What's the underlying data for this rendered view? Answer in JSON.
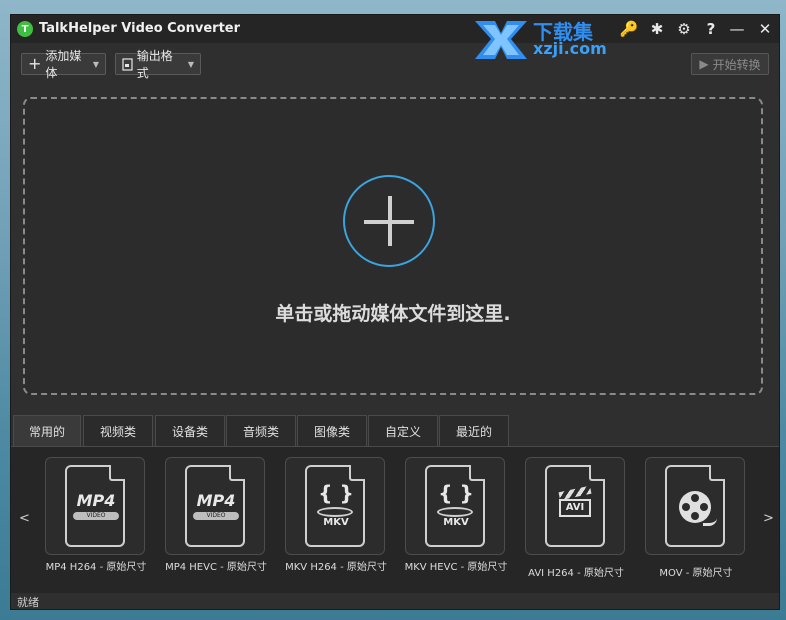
{
  "window": {
    "title": "TalkHelper Video Converter",
    "logo_letter": "T"
  },
  "watermark": {
    "line1": "下载集",
    "line2": "xzji.com"
  },
  "titlebar_icons": {
    "key": "🔑",
    "bug": "✱",
    "settings": "⚙",
    "help": "?",
    "minimize": "—",
    "close": "✕"
  },
  "toolbar": {
    "add_media_label": "添加媒体",
    "output_format_label": "输出格式",
    "start_convert_label": "开始转换"
  },
  "dropzone": {
    "hint": "单击或拖动媒体文件到这里."
  },
  "tabs": [
    {
      "label": "常用的",
      "active": true
    },
    {
      "label": "视频类",
      "active": false
    },
    {
      "label": "设备类",
      "active": false
    },
    {
      "label": "音频类",
      "active": false
    },
    {
      "label": "图像类",
      "active": false
    },
    {
      "label": "自定义",
      "active": false
    },
    {
      "label": "最近的",
      "active": false
    }
  ],
  "presets": [
    {
      "label": "MP4 H264 - 原始尺寸",
      "icon": "mp4-icon",
      "mark": "MP4",
      "sub": "VIDEO"
    },
    {
      "label": "MP4 HEVC - 原始尺寸",
      "icon": "mp4-icon",
      "mark": "MP4",
      "sub": "VIDEO"
    },
    {
      "label": "MKV H264 - 原始尺寸",
      "icon": "mkv-icon",
      "mark": "MKV"
    },
    {
      "label": "MKV HEVC - 原始尺寸",
      "icon": "mkv-icon",
      "mark": "MKV"
    },
    {
      "label": "AVI H264 - 原始尺寸",
      "icon": "avi-icon",
      "mark": "AVI"
    },
    {
      "label": "MOV - 原始尺寸",
      "icon": "film-reel-icon"
    }
  ],
  "nav": {
    "prev": "<",
    "next": ">"
  },
  "status": {
    "text": "就绪"
  },
  "colors": {
    "accent": "#3aa4e0",
    "logo": "#3fbf3f",
    "watermark": "#2f8ef0"
  }
}
